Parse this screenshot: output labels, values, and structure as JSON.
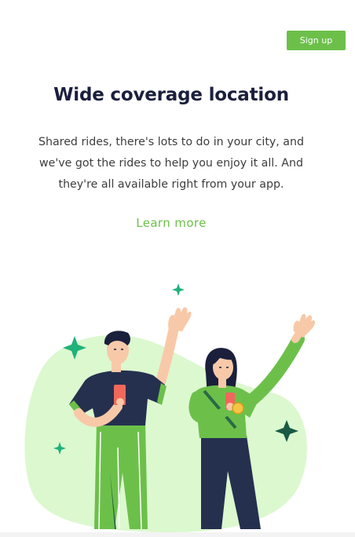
{
  "header": {
    "signup_label": "Sign up"
  },
  "hero": {
    "title": "Wide coverage location",
    "description": "Shared rides, there's lots to do in your city, and we've got the rides to help you enjoy it all. And they're all available right from your app.",
    "learn_more_label": "Learn more"
  },
  "colors": {
    "accent_green": "#6cc04a",
    "title_navy": "#1a1f3c",
    "blob_light_green": "#dcf8cf",
    "sparkle_teal": "#1fb27a",
    "shirt_navy": "#25304f"
  },
  "illustration": {
    "subject": "two-people-waving-with-phones"
  }
}
